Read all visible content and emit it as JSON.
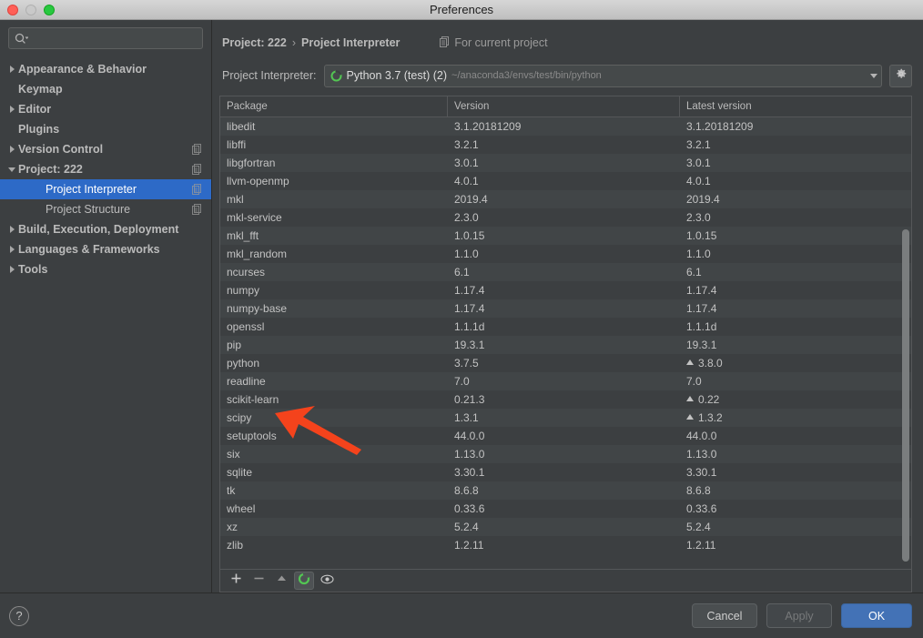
{
  "window": {
    "title": "Preferences",
    "controls": [
      "close",
      "minimize",
      "zoom"
    ]
  },
  "sidebar": {
    "search": {
      "value": "",
      "placeholder": ""
    },
    "items": [
      {
        "label": "Appearance & Behavior",
        "arrow": "right",
        "indent": 0,
        "badge": false,
        "selected": false
      },
      {
        "label": "Keymap",
        "arrow": "none",
        "indent": 0,
        "badge": false,
        "selected": false
      },
      {
        "label": "Editor",
        "arrow": "right",
        "indent": 0,
        "badge": false,
        "selected": false
      },
      {
        "label": "Plugins",
        "arrow": "none",
        "indent": 0,
        "badge": false,
        "selected": false
      },
      {
        "label": "Version Control",
        "arrow": "right",
        "indent": 0,
        "badge": true,
        "selected": false
      },
      {
        "label": "Project: 222",
        "arrow": "down",
        "indent": 0,
        "badge": true,
        "selected": false
      },
      {
        "label": "Project Interpreter",
        "arrow": "none",
        "indent": 1,
        "badge": true,
        "selected": true
      },
      {
        "label": "Project Structure",
        "arrow": "none",
        "indent": 1,
        "badge": true,
        "selected": false
      },
      {
        "label": "Build, Execution, Deployment",
        "arrow": "right",
        "indent": 0,
        "badge": false,
        "selected": false
      },
      {
        "label": "Languages & Frameworks",
        "arrow": "right",
        "indent": 0,
        "badge": false,
        "selected": false
      },
      {
        "label": "Tools",
        "arrow": "right",
        "indent": 0,
        "badge": false,
        "selected": false
      }
    ]
  },
  "main": {
    "breadcrumb": {
      "root": "Project: 222",
      "separator": "›",
      "leaf": "Project Interpreter"
    },
    "for_current_project": "For current project",
    "interpreter": {
      "label": "Project Interpreter:",
      "name": "Python 3.7 (test) (2)",
      "path": "~/anaconda3/envs/test/bin/python"
    },
    "table": {
      "columns": [
        "Package",
        "Version",
        "Latest version"
      ],
      "rows": [
        {
          "package": "libedit",
          "version": "3.1.20181209",
          "latest": "3.1.20181209",
          "upgrade": false
        },
        {
          "package": "libffi",
          "version": "3.2.1",
          "latest": "3.2.1",
          "upgrade": false
        },
        {
          "package": "libgfortran",
          "version": "3.0.1",
          "latest": "3.0.1",
          "upgrade": false
        },
        {
          "package": "llvm-openmp",
          "version": "4.0.1",
          "latest": "4.0.1",
          "upgrade": false
        },
        {
          "package": "mkl",
          "version": "2019.4",
          "latest": "2019.4",
          "upgrade": false
        },
        {
          "package": "mkl-service",
          "version": "2.3.0",
          "latest": "2.3.0",
          "upgrade": false
        },
        {
          "package": "mkl_fft",
          "version": "1.0.15",
          "latest": "1.0.15",
          "upgrade": false
        },
        {
          "package": "mkl_random",
          "version": "1.1.0",
          "latest": "1.1.0",
          "upgrade": false
        },
        {
          "package": "ncurses",
          "version": "6.1",
          "latest": "6.1",
          "upgrade": false
        },
        {
          "package": "numpy",
          "version": "1.17.4",
          "latest": "1.17.4",
          "upgrade": false
        },
        {
          "package": "numpy-base",
          "version": "1.17.4",
          "latest": "1.17.4",
          "upgrade": false
        },
        {
          "package": "openssl",
          "version": "1.1.1d",
          "latest": "1.1.1d",
          "upgrade": false
        },
        {
          "package": "pip",
          "version": "19.3.1",
          "latest": "19.3.1",
          "upgrade": false
        },
        {
          "package": "python",
          "version": "3.7.5",
          "latest": "3.8.0",
          "upgrade": true
        },
        {
          "package": "readline",
          "version": "7.0",
          "latest": "7.0",
          "upgrade": false
        },
        {
          "package": "scikit-learn",
          "version": "0.21.3",
          "latest": "0.22",
          "upgrade": true
        },
        {
          "package": "scipy",
          "version": "1.3.1",
          "latest": "1.3.2",
          "upgrade": true
        },
        {
          "package": "setuptools",
          "version": "44.0.0",
          "latest": "44.0.0",
          "upgrade": false
        },
        {
          "package": "six",
          "version": "1.13.0",
          "latest": "1.13.0",
          "upgrade": false
        },
        {
          "package": "sqlite",
          "version": "3.30.1",
          "latest": "3.30.1",
          "upgrade": false
        },
        {
          "package": "tk",
          "version": "8.6.8",
          "latest": "8.6.8",
          "upgrade": false
        },
        {
          "package": "wheel",
          "version": "0.33.6",
          "latest": "0.33.6",
          "upgrade": false
        },
        {
          "package": "xz",
          "version": "5.2.4",
          "latest": "5.2.4",
          "upgrade": false
        },
        {
          "package": "zlib",
          "version": "1.2.11",
          "latest": "1.2.11",
          "upgrade": false
        }
      ]
    },
    "table_toolbar": [
      {
        "icon": "plus-icon",
        "active": false
      },
      {
        "icon": "minus-icon",
        "active": false
      },
      {
        "icon": "upgrade-icon",
        "active": false
      },
      {
        "icon": "conda-icon",
        "active": true
      },
      {
        "icon": "eye-icon",
        "active": false
      }
    ]
  },
  "footer": {
    "help": "?",
    "cancel": "Cancel",
    "apply": "Apply",
    "ok": "OK"
  },
  "annotation": {
    "type": "arrow",
    "color": "#f4431c",
    "points_at": "scikit-learn"
  },
  "colors": {
    "window_bg": "#3c3f41",
    "selection_blue": "#2d6ac7",
    "primary_button": "#4372b6",
    "python_green": "#4caf50",
    "annotation_red": "#f4431c"
  }
}
